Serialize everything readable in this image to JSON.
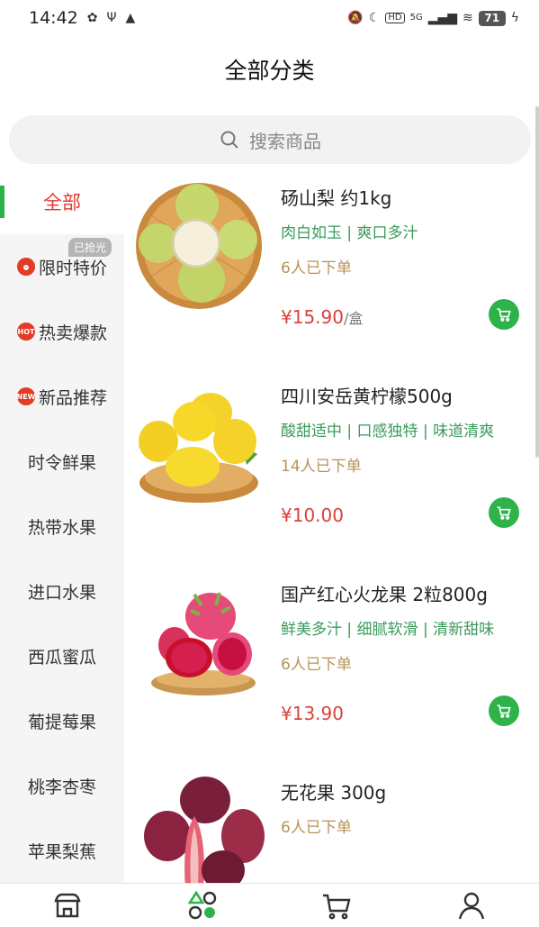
{
  "status_bar": {
    "time": "14:42",
    "network": "5G",
    "battery": "71"
  },
  "header": {
    "title": "全部分类"
  },
  "search": {
    "placeholder": "搜索商品"
  },
  "sidebar": {
    "items": [
      {
        "label": "全部",
        "active": true
      },
      {
        "label": "限时特价",
        "icon": "alarm-clock-icon",
        "badge": "已抢光"
      },
      {
        "label": "热卖爆款",
        "icon": "hot-flame-icon",
        "icon_text": "HOT"
      },
      {
        "label": "新品推荐",
        "icon": "new-badge-icon",
        "icon_text": "NEW"
      },
      {
        "label": "时令鲜果"
      },
      {
        "label": "热带水果"
      },
      {
        "label": "进口水果"
      },
      {
        "label": "西瓜蜜瓜"
      },
      {
        "label": "葡提莓果"
      },
      {
        "label": "桃李杏枣"
      },
      {
        "label": "苹果梨蕉"
      }
    ]
  },
  "products": [
    {
      "name": "砀山梨 约1kg",
      "tags": "肉白如玉 | 爽口多汁",
      "sold": "6人已下单",
      "price": "¥15.90",
      "unit": "/盒",
      "image": "pear-basket"
    },
    {
      "name": "四川安岳黄柠檬500g",
      "tags": "酸甜适中 | 口感独特 | 味道清爽",
      "sold": "14人已下单",
      "price": "¥10.00",
      "unit": "",
      "image": "lemon-basket"
    },
    {
      "name": "国产红心火龙果 2粒800g",
      "tags": "鲜美多汁 | 细腻软滑 | 清新甜味",
      "sold": "6人已下单",
      "price": "¥13.90",
      "unit": "",
      "image": "dragonfruit-plate"
    },
    {
      "name": "无花果 300g",
      "tags": "",
      "sold": "6人已下单",
      "price": "",
      "unit": "",
      "image": "fig-pile"
    }
  ],
  "tabbar": {
    "items": [
      {
        "icon": "shop-icon",
        "active": false
      },
      {
        "icon": "category-icon",
        "active": true
      },
      {
        "icon": "cart-icon",
        "active": false
      },
      {
        "icon": "profile-icon",
        "active": false
      }
    ]
  },
  "colors": {
    "accent_green": "#2db34a",
    "price_red": "#d9423a",
    "tag_green": "#3a9b5a",
    "sold_gold": "#b8935a",
    "active_red": "#e03a2f"
  }
}
